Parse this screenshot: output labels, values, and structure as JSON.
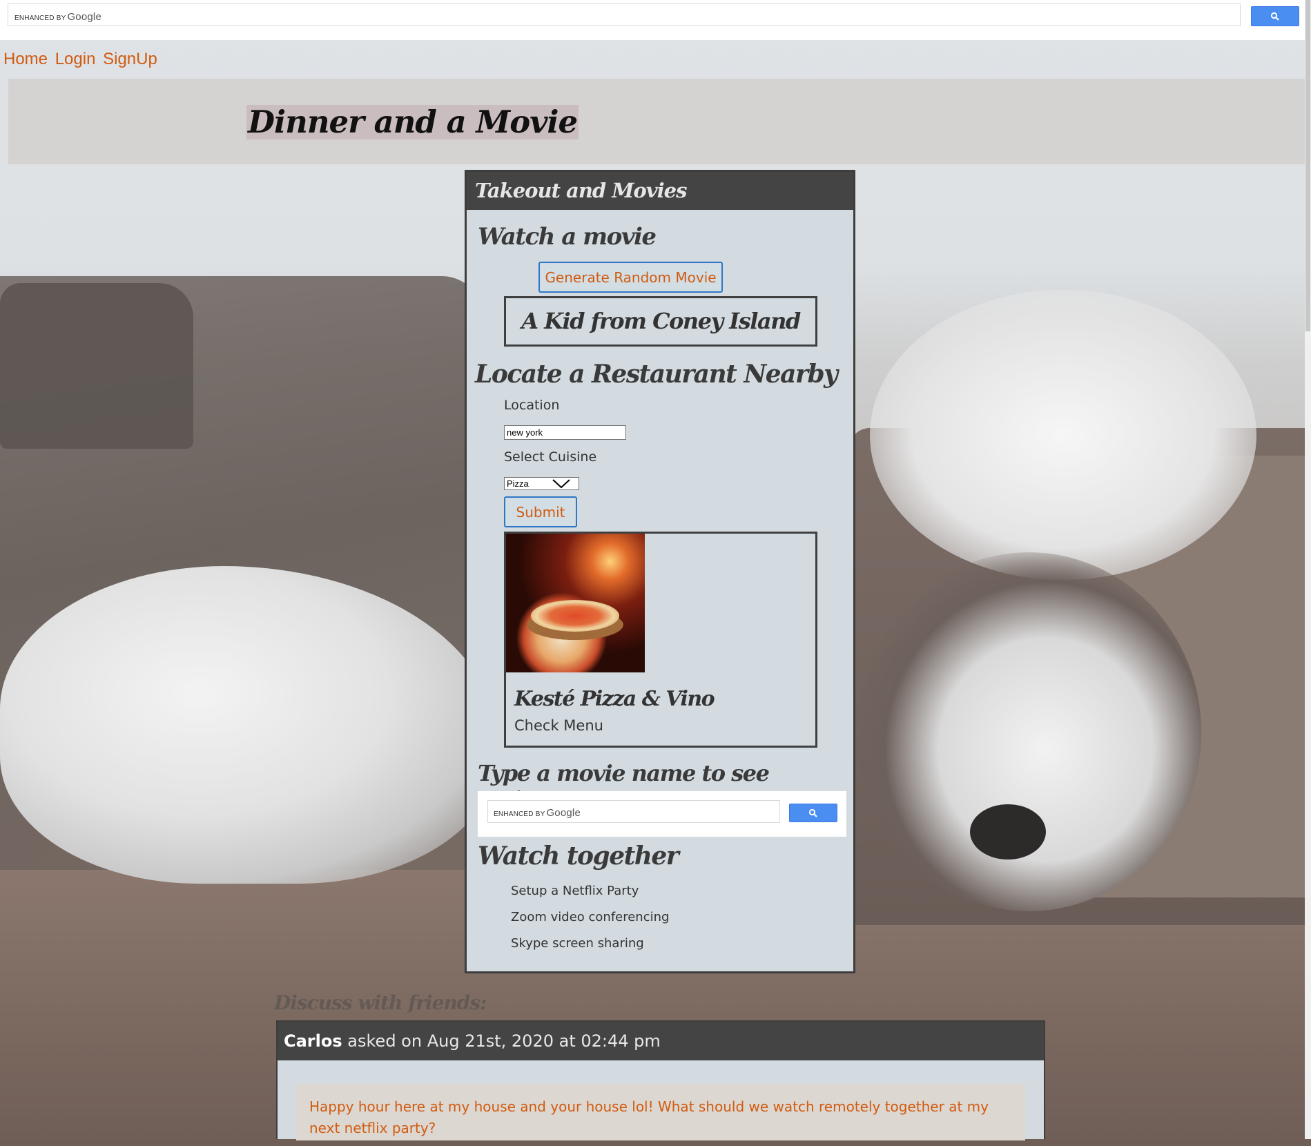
{
  "google_search": {
    "enhanced_by": "ENHANCED BY",
    "google_word": "Google",
    "button_icon": "search-icon"
  },
  "nav": {
    "items": [
      {
        "label": "Home"
      },
      {
        "label": "Login"
      },
      {
        "label": "SignUp"
      }
    ],
    "link_color": "#d15b10"
  },
  "header": {
    "title": "Dinner and a Movie"
  },
  "panel": {
    "heading": "Takeout and Movies",
    "watch_movie": {
      "heading": "Watch a movie",
      "button_label": "Generate Random Movie",
      "movie_title": "A Kid from Coney Island"
    },
    "restaurant": {
      "heading": "Locate a Restaurant Nearby",
      "location_label": "Location",
      "location_value": "new york",
      "cuisine_label": "Select Cuisine",
      "cuisine_selected": "Pizza",
      "submit_label": "Submit",
      "result": {
        "name": "Kesté Pizza & Vino",
        "link": "Check Menu"
      }
    },
    "reviews": {
      "heading": "Type a movie name to see reviews",
      "enhanced_by": "ENHANCED BY",
      "google_word": "Google"
    },
    "watch_together": {
      "heading": "Watch together",
      "items": [
        "Setup a Netflix Party",
        "Zoom video conferencing",
        "Skype screen sharing"
      ]
    }
  },
  "discussion": {
    "label": "Discuss with friends:",
    "post": {
      "author": "Carlos",
      "meta": "asked on Aug 21st, 2020 at 02:44 pm",
      "body": "Happy hour here at my house and your house lol! What should we watch remotely together at my next netflix party?"
    }
  },
  "colors": {
    "accent": "#d15b10",
    "panel_bg": "#d3dbe0",
    "panel_header": "#444444",
    "google_button": "#4b8ef1"
  }
}
